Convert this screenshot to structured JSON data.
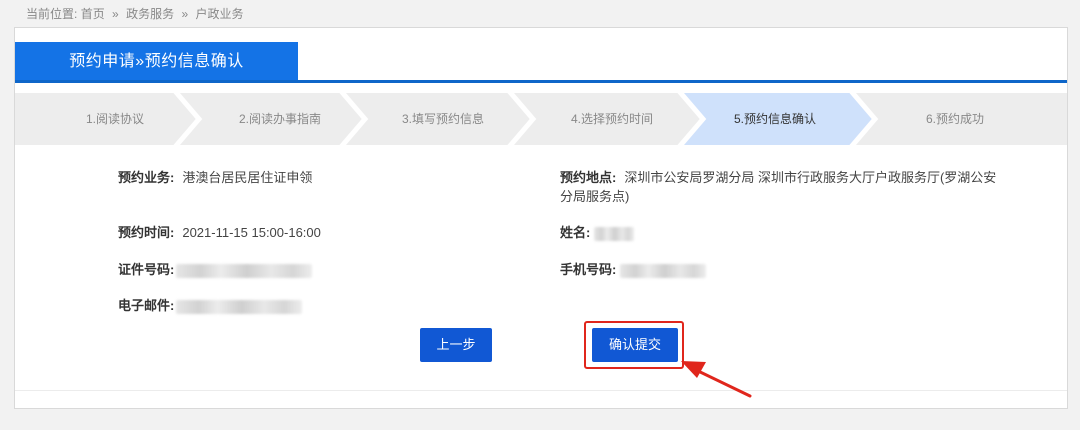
{
  "breadcrumb": {
    "prefix": "当前位置:",
    "items": [
      "首页",
      "政务服务",
      "户政业务"
    ],
    "separator": "»"
  },
  "tab": {
    "label": "预约申请»预约信息确认"
  },
  "steps": [
    {
      "label": "1.阅读协议",
      "active": false
    },
    {
      "label": "2.阅读办事指南",
      "active": false
    },
    {
      "label": "3.填写预约信息",
      "active": false
    },
    {
      "label": "4.选择预约时间",
      "active": false
    },
    {
      "label": "5.预约信息确认",
      "active": true
    },
    {
      "label": "6.预约成功",
      "active": false
    }
  ],
  "info": {
    "business": {
      "label": "预约业务:",
      "value": "港澳台居民居住证申领"
    },
    "location": {
      "label": "预约地点:",
      "value": "深圳市公安局罗湖分局 深圳市行政服务大厅户政服务厅(罗湖公安分局服务点)"
    },
    "time": {
      "label": "预约时间:",
      "value": "2021-11-15 15:00-16:00"
    },
    "name": {
      "label": "姓名:"
    },
    "id_number": {
      "label": "证件号码:"
    },
    "phone": {
      "label": "手机号码:"
    },
    "email": {
      "label": "电子邮件:"
    }
  },
  "buttons": {
    "prev": "上一步",
    "confirm": "确认提交"
  },
  "colors": {
    "accent": "#1473e6",
    "button": "#1158d4",
    "step_active": "#cfe1fb",
    "step_inactive": "#ededed",
    "annotation": "#e0261c"
  }
}
